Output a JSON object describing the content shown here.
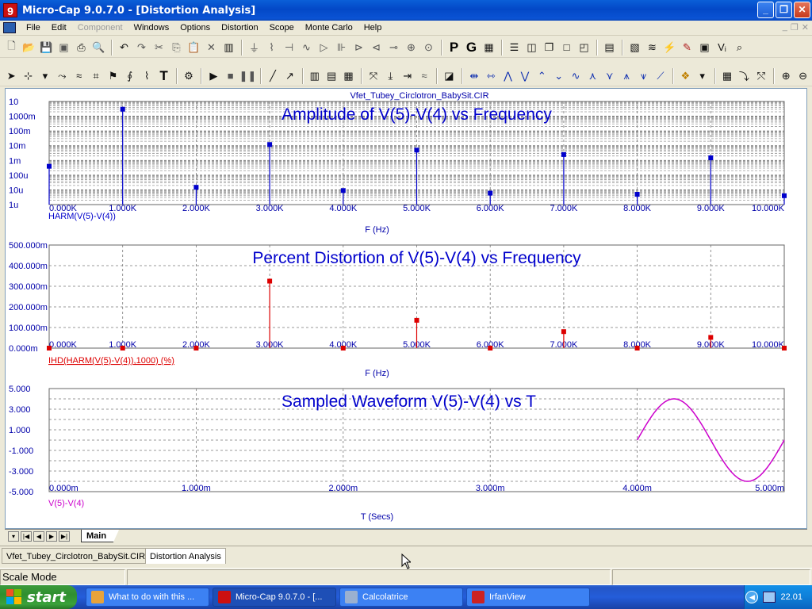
{
  "window": {
    "title": "Micro-Cap 9.0.7.0 - [Distortion Analysis]",
    "app_icon_glyph": "9",
    "min_label": "_",
    "max_label": "❐",
    "close_label": "✕"
  },
  "menu": {
    "items": [
      "File",
      "Edit",
      "Component",
      "Windows",
      "Options",
      "Distortion",
      "Scope",
      "Monte Carlo",
      "Help"
    ],
    "mdi_min": "_",
    "mdi_restore": "❐",
    "mdi_close": "✕"
  },
  "toolbar": {
    "probe_p": "P",
    "probe_g": "G",
    "text_tool": "T"
  },
  "chart_window": {
    "file_label": "Vfet_Tubey_Circlotron_BabySit.CIR"
  },
  "chart_data": [
    {
      "type": "bar",
      "title": "Amplitude of V(5)-V(4) vs Frequency",
      "xlabel": "F (Hz)",
      "ylabel": "",
      "yscale": "log",
      "series_label": "HARM(V(5)-V(4))",
      "color": "#0000cc",
      "x": [
        0,
        1000,
        2000,
        3000,
        4000,
        5000,
        6000,
        7000,
        8000,
        9000,
        10000
      ],
      "values": [
        0.0004,
        3.0,
        1.5e-05,
        0.012,
        9e-06,
        0.005,
        6e-06,
        0.0025,
        5e-06,
        0.0015,
        4e-06
      ],
      "xlim": [
        0,
        10000
      ],
      "ylim": [
        1e-06,
        10
      ],
      "x_ticks": [
        "0.000K",
        "1.000K",
        "2.000K",
        "3.000K",
        "4.000K",
        "5.000K",
        "6.000K",
        "7.000K",
        "8.000K",
        "9.000K",
        "10.000K"
      ],
      "y_ticks": [
        "10",
        "1000m",
        "100m",
        "10m",
        "1m",
        "100u",
        "10u",
        "1u"
      ],
      "grid": true
    },
    {
      "type": "bar",
      "title": "Percent Distortion of V(5)-V(4) vs Frequency",
      "xlabel": "F (Hz)",
      "ylabel": "",
      "series_label": "IHD(HARM(V(5)-V(4)),1000) (%)",
      "color": "#dd0000",
      "x": [
        0,
        1000,
        2000,
        3000,
        4000,
        5000,
        6000,
        7000,
        8000,
        9000,
        10000
      ],
      "values": [
        0,
        0,
        0,
        325,
        0,
        135,
        0,
        80,
        0,
        52,
        0
      ],
      "xlim": [
        0,
        10000
      ],
      "ylim": [
        0,
        500
      ],
      "x_ticks": [
        "0.000K",
        "1.000K",
        "2.000K",
        "3.000K",
        "4.000K",
        "5.000K",
        "6.000K",
        "7.000K",
        "8.000K",
        "9.000K",
        "10.000K"
      ],
      "y_ticks": [
        "500.000m",
        "400.000m",
        "300.000m",
        "200.000m",
        "100.000m",
        "0.000m"
      ],
      "grid": true
    },
    {
      "type": "line",
      "title": "Sampled Waveform  V(5)-V(4) vs T",
      "xlabel": "T (Secs)",
      "ylabel": "",
      "series_label": "V(5)-V(4)",
      "color": "#cc00cc",
      "x_range_start": 0.004,
      "x_range_end": 0.005,
      "amplitude": 4.0,
      "frequency": 1000,
      "xlim": [
        0,
        0.005
      ],
      "ylim": [
        -5,
        5
      ],
      "x_ticks": [
        "0.000m",
        "1.000m",
        "2.000m",
        "3.000m",
        "4.000m",
        "5.000m"
      ],
      "y_ticks": [
        "5.000",
        "3.000",
        "1.000",
        "-1.000",
        "-3.000",
        "-5.000"
      ],
      "grid": true
    }
  ],
  "sheet_tabs": {
    "main_label": "Main"
  },
  "doc_tabs": [
    "Vfet_Tubey_Circlotron_BabySit.CIR",
    "Distortion Analysis"
  ],
  "status": {
    "mode": "Scale Mode"
  },
  "taskbar": {
    "start_label": "start",
    "buttons": [
      {
        "label": "What to do with this ...",
        "color": "#e8a33a"
      },
      {
        "label": "Micro-Cap 9.0.7.0 - [...",
        "color": "#cc1010"
      },
      {
        "label": "Calcolatrice",
        "color": "#9ab0d0"
      },
      {
        "label": "IrfanView",
        "color": "#cc2222"
      }
    ],
    "clock": "22.01"
  }
}
